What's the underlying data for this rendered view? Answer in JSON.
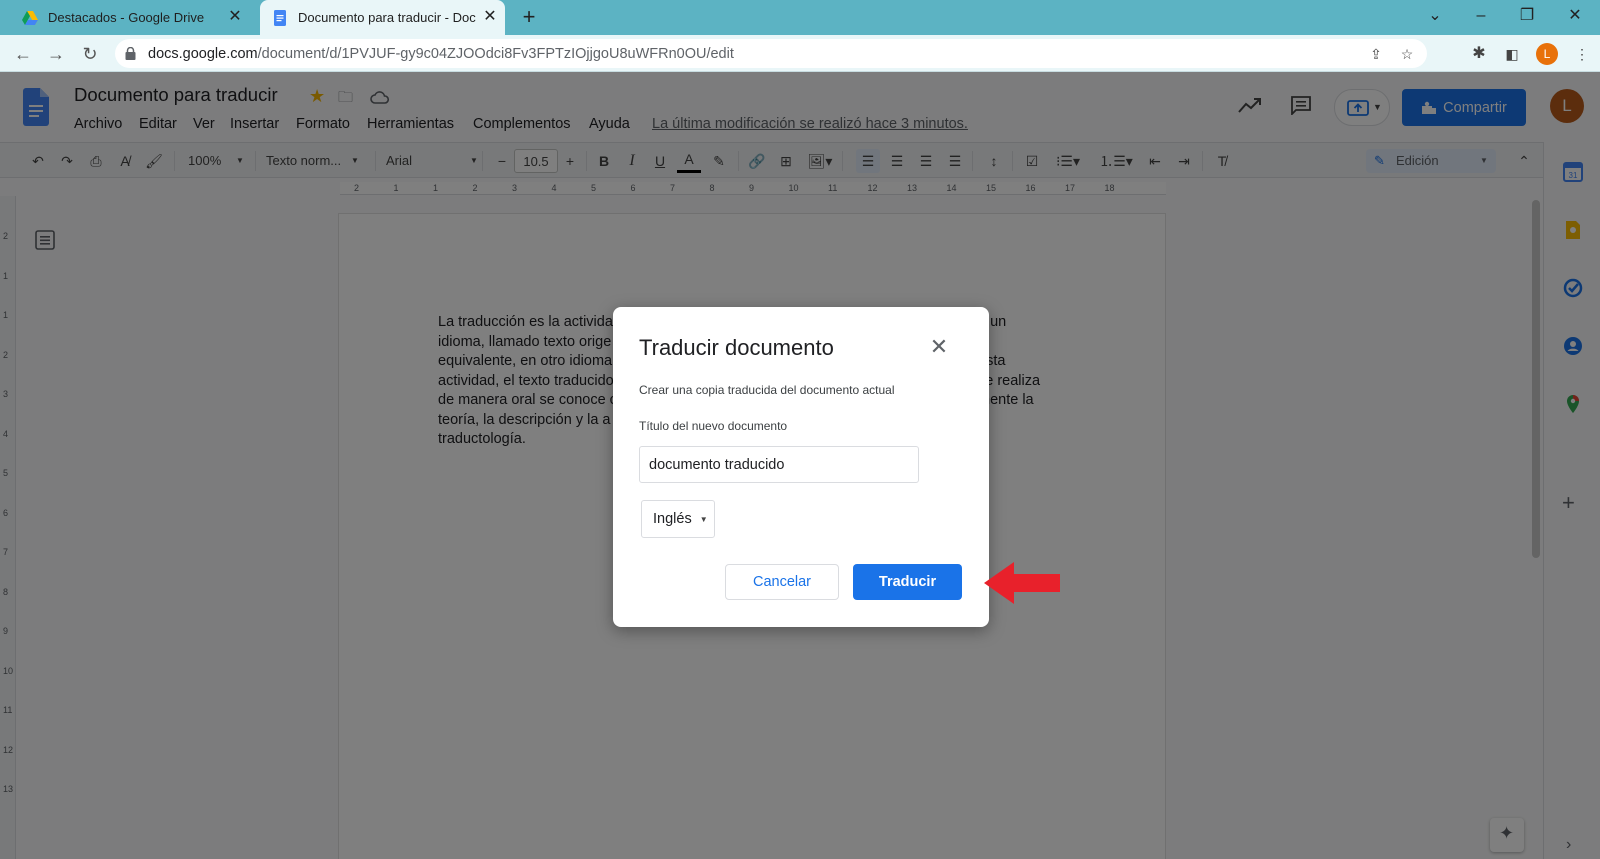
{
  "browser": {
    "tabs": [
      {
        "title": "Destacados - Google Drive"
      },
      {
        "title": "Documento para traducir - Documentos de Google"
      }
    ],
    "url_host": "docs.google.com",
    "url_path": "/document/d/1PVJUF-gy9c04ZJOOdci8Fv3FPTzIOjjgoU8uWFRn0OU/edit",
    "profile_initial": "L"
  },
  "docs": {
    "title": "Documento para traducir",
    "menu": [
      "Archivo",
      "Editar",
      "Ver",
      "Insertar",
      "Formato",
      "Herramientas",
      "Complementos",
      "Ayuda"
    ],
    "last_edit": "La última modificación se realizó hace 3 minutos.",
    "share_label": "Compartir",
    "user_initial": "L"
  },
  "toolbar": {
    "zoom": "100%",
    "style": "Texto norm...",
    "font": "Arial",
    "font_size": "10.5",
    "mode": "Edición"
  },
  "ruler": {
    "ticks": [
      "2",
      "1",
      "1",
      "2",
      "3",
      "4",
      "5",
      "6",
      "7",
      "8",
      "9",
      "10",
      "11",
      "12",
      "13",
      "14",
      "15",
      "16",
      "17",
      "18"
    ]
  },
  "vruler": {
    "ticks": [
      "2",
      "1",
      "1",
      "2",
      "3",
      "4",
      "5",
      "6",
      "7",
      "8",
      "9",
      "10",
      "11",
      "12",
      "13"
    ]
  },
  "document": {
    "lines": [
      "La traducción es la activida",
      "idioma, llamado texto orige",
      "equivalente, en otro idioma",
      "actividad, el texto traducido",
      "de manera oral se conoce c",
      "teoría, la descripción y la a",
      "traductología."
    ],
    "lines_right": [
      "n un",
      "o",
      "esta",
      "se realiza",
      "mente la",
      "",
      ""
    ]
  },
  "dialog": {
    "title": "Traducir documento",
    "description": "Crear una copia traducida del documento actual",
    "field_label": "Título del nuevo documento",
    "field_value": "documento traducido",
    "language": "Inglés",
    "cancel_label": "Cancelar",
    "translate_label": "Traducir"
  },
  "colors": {
    "accent": "#1a73e8",
    "annotation_arrow": "#e8212b",
    "tab_strip": "#5cb3c3"
  }
}
